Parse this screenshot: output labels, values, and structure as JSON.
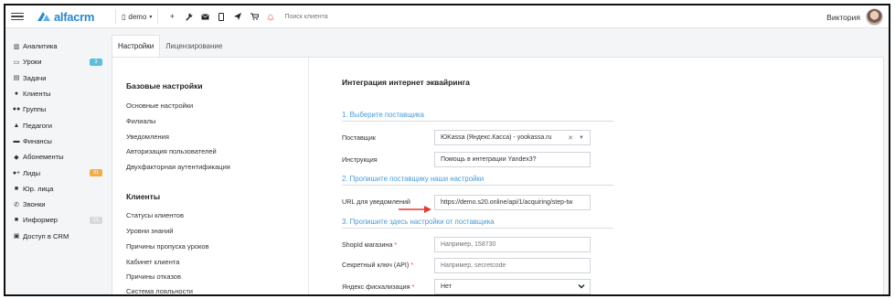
{
  "brand": {
    "logo_text": "alfacrm",
    "accent": "#2f86c9"
  },
  "topbar": {
    "branch": "demo",
    "tools": [
      "plus-icon",
      "wrench-icon",
      "mail-icon",
      "phone-icon",
      "send-icon",
      "cart-icon",
      "bell-icon"
    ],
    "search_placeholder": "Поиск клиента",
    "user_name": "Виктория"
  },
  "sidebar": {
    "items": [
      {
        "label": "Аналитика",
        "icon": "chart-icon"
      },
      {
        "label": "Уроки",
        "icon": "calendar-icon",
        "badge": "3",
        "badge_color": "#5bc0de"
      },
      {
        "label": "Задачи",
        "icon": "tasks-icon"
      },
      {
        "label": "Клиенты",
        "icon": "user-icon"
      },
      {
        "label": "Группы",
        "icon": "users-icon"
      },
      {
        "label": "Педагоги",
        "icon": "graduation-icon"
      },
      {
        "label": "Финансы",
        "icon": "money-icon"
      },
      {
        "label": "Абонементы",
        "icon": "tag-icon"
      },
      {
        "label": "Лиды",
        "icon": "add-user-icon",
        "badge": "31",
        "badge_color": "#f0ad4e"
      },
      {
        "label": "Юр. лица",
        "icon": "building-icon"
      },
      {
        "label": "Звонки",
        "icon": "phone-icon"
      },
      {
        "label": "Информер",
        "icon": "informer-icon",
        "badge": "11",
        "badge_color": "#d6d9dd"
      },
      {
        "label": "Доступ в CRM",
        "icon": "lock-icon"
      }
    ]
  },
  "tabs": [
    {
      "label": "Настройки",
      "active": true
    },
    {
      "label": "Лицензирование",
      "active": false
    }
  ],
  "menu": {
    "base_title": "Базовые настройки",
    "base_links": [
      "Основные настройки",
      "Филиалы",
      "Уведомления",
      "Авторизация пользователей",
      "Двухфакторная аутентификация"
    ],
    "clients_title": "Клиенты",
    "client_links": [
      "Статусы клиентов",
      "Уровни знаний",
      "Причины пропуска уроков",
      "Кабинет клиента",
      "Причины отказов",
      "Система лояльности"
    ]
  },
  "form": {
    "title": "Интеграция интернет эквайринга",
    "section1": "1. Выберите поставщика",
    "provider_label": "Поставщик",
    "provider_value": "ЮKassa (Яндекс.Касса) - yookassa.ru",
    "instruction_label": "Инструкция",
    "instruction_value": "Помощь в интеграции Yandex3?",
    "section2": "2. Пропишите поставщику наши настройки",
    "url_label": "URL для уведомлений",
    "url_value": "https://demo.s20.online/api/1/acquiring/step-tw",
    "section3": "3. Пропишите здесь настройки от поставщика",
    "shop_label": "ShopId магазина",
    "shop_placeholder": "Например, 158730",
    "secret_label": "Секретный ключ (API)",
    "secret_placeholder": "Например, secretcode",
    "fiscal_label": "Яндекс фискализация",
    "fiscal_value": "Нет",
    "required_mark": "*",
    "arrow_color": "#e03b35"
  }
}
